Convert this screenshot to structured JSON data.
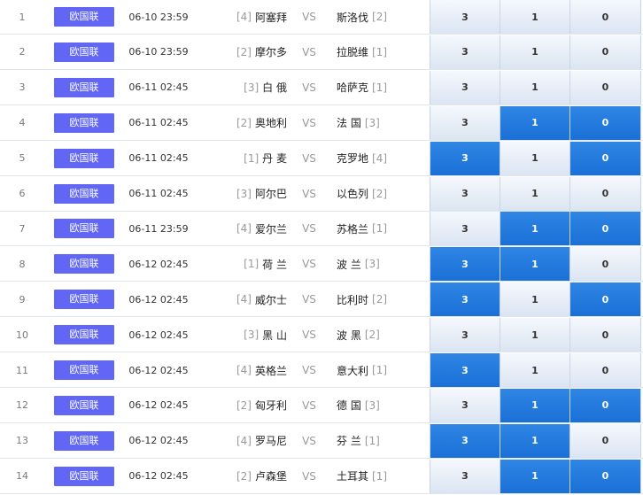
{
  "league_label": "欧国联",
  "vs_label": "VS",
  "matches": [
    {
      "index": "1",
      "time": "06-10 23:59",
      "home_rank": "[4]",
      "home": "阿塞拜",
      "away": "斯洛伐",
      "away_rank": "[2]",
      "odds": [
        "3",
        "1",
        "0"
      ],
      "selected": [
        false,
        false,
        false
      ]
    },
    {
      "index": "2",
      "time": "06-10 23:59",
      "home_rank": "[2]",
      "home": "摩尔多",
      "away": "拉脱维",
      "away_rank": "[1]",
      "odds": [
        "3",
        "1",
        "0"
      ],
      "selected": [
        false,
        false,
        false
      ]
    },
    {
      "index": "3",
      "time": "06-11 02:45",
      "home_rank": "[3]",
      "home": "白 俄",
      "away": "哈萨克",
      "away_rank": "[1]",
      "odds": [
        "3",
        "1",
        "0"
      ],
      "selected": [
        false,
        false,
        false
      ]
    },
    {
      "index": "4",
      "time": "06-11 02:45",
      "home_rank": "[2]",
      "home": "奥地利",
      "away": "法 国",
      "away_rank": "[3]",
      "odds": [
        "3",
        "1",
        "0"
      ],
      "selected": [
        false,
        true,
        true
      ]
    },
    {
      "index": "5",
      "time": "06-11 02:45",
      "home_rank": "[1]",
      "home": "丹 麦",
      "away": "克罗地",
      "away_rank": "[4]",
      "odds": [
        "3",
        "1",
        "0"
      ],
      "selected": [
        true,
        false,
        true
      ]
    },
    {
      "index": "6",
      "time": "06-11 02:45",
      "home_rank": "[3]",
      "home": "阿尔巴",
      "away": "以色列",
      "away_rank": "[2]",
      "odds": [
        "3",
        "1",
        "0"
      ],
      "selected": [
        false,
        false,
        false
      ]
    },
    {
      "index": "7",
      "time": "06-11 23:59",
      "home_rank": "[4]",
      "home": "爱尔兰",
      "away": "苏格兰",
      "away_rank": "[1]",
      "odds": [
        "3",
        "1",
        "0"
      ],
      "selected": [
        false,
        true,
        true
      ]
    },
    {
      "index": "8",
      "time": "06-12 02:45",
      "home_rank": "[1]",
      "home": "荷 兰",
      "away": "波 兰",
      "away_rank": "[3]",
      "odds": [
        "3",
        "1",
        "0"
      ],
      "selected": [
        true,
        true,
        false
      ]
    },
    {
      "index": "9",
      "time": "06-12 02:45",
      "home_rank": "[4]",
      "home": "威尔士",
      "away": "比利时",
      "away_rank": "[2]",
      "odds": [
        "3",
        "1",
        "0"
      ],
      "selected": [
        true,
        false,
        true
      ]
    },
    {
      "index": "10",
      "time": "06-12 02:45",
      "home_rank": "[3]",
      "home": "黑 山",
      "away": "波 黑",
      "away_rank": "[2]",
      "odds": [
        "3",
        "1",
        "0"
      ],
      "selected": [
        false,
        false,
        false
      ]
    },
    {
      "index": "11",
      "time": "06-12 02:45",
      "home_rank": "[4]",
      "home": "英格兰",
      "away": "意大利",
      "away_rank": "[1]",
      "odds": [
        "3",
        "1",
        "0"
      ],
      "selected": [
        true,
        false,
        false
      ]
    },
    {
      "index": "12",
      "time": "06-12 02:45",
      "home_rank": "[2]",
      "home": "匈牙利",
      "away": "德 国",
      "away_rank": "[3]",
      "odds": [
        "3",
        "1",
        "0"
      ],
      "selected": [
        false,
        true,
        true
      ]
    },
    {
      "index": "13",
      "time": "06-12 02:45",
      "home_rank": "[4]",
      "home": "罗马尼",
      "away": "芬 兰",
      "away_rank": "[1]",
      "odds": [
        "3",
        "1",
        "0"
      ],
      "selected": [
        true,
        true,
        false
      ]
    },
    {
      "index": "14",
      "time": "06-12 02:45",
      "home_rank": "[2]",
      "home": "卢森堡",
      "away": "土耳其",
      "away_rank": "[1]",
      "odds": [
        "3",
        "1",
        "0"
      ],
      "selected": [
        false,
        true,
        true
      ]
    }
  ],
  "colors": {
    "league_badge": "#6166f5",
    "selected_odd": "#1f7ae0",
    "unselected_odd": "#e8eef7"
  }
}
